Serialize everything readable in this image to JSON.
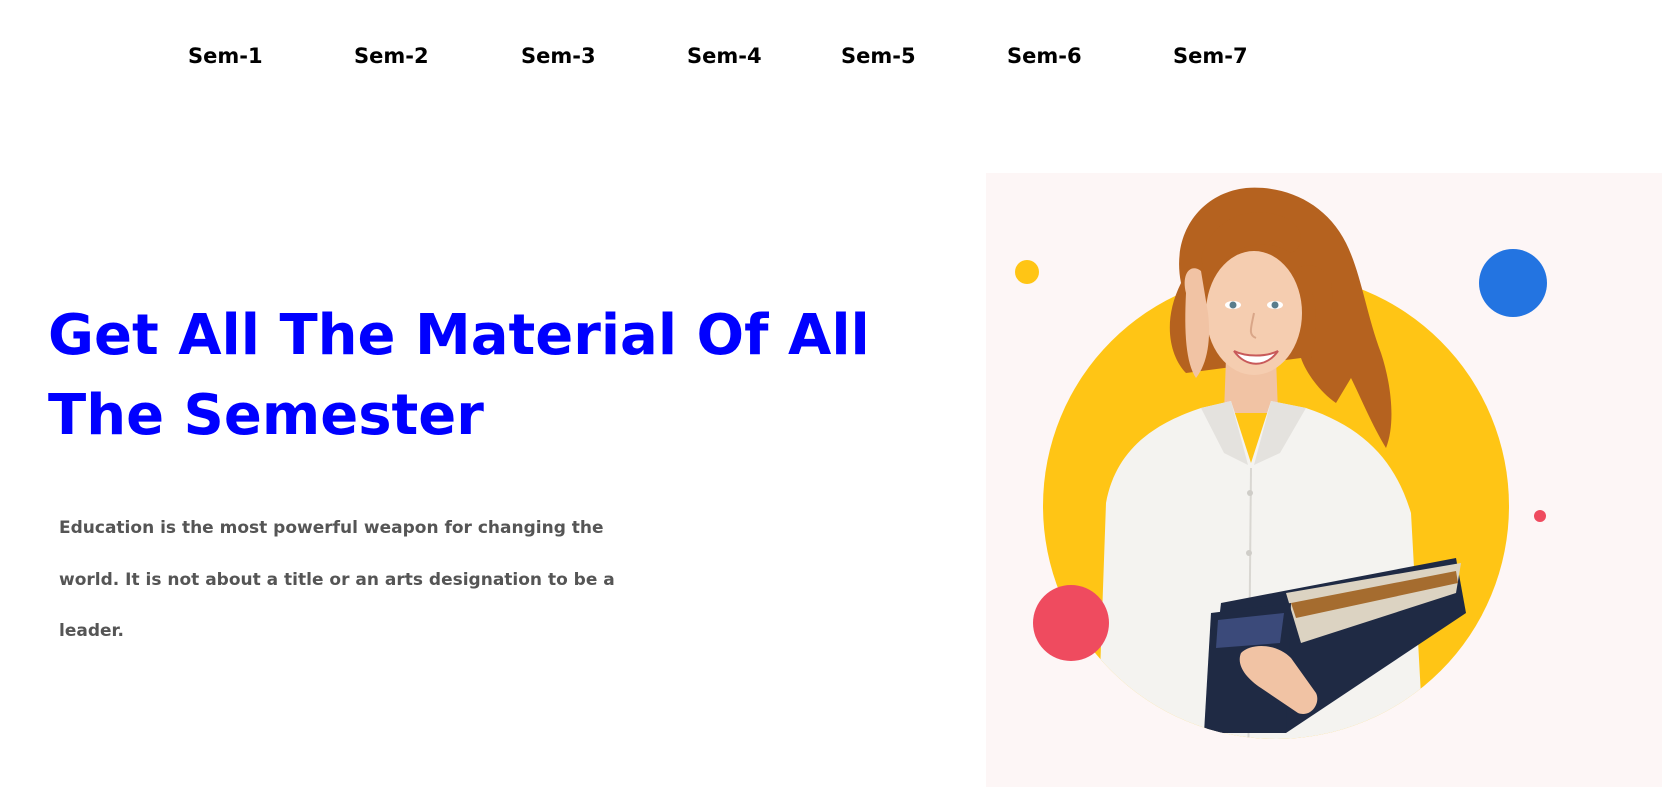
{
  "nav": {
    "items": [
      {
        "label": "Sem-1"
      },
      {
        "label": "Sem-2"
      },
      {
        "label": "Sem-3"
      },
      {
        "label": "Sem-4"
      },
      {
        "label": "Sem-5"
      },
      {
        "label": "Sem-6"
      },
      {
        "label": "Sem-7"
      }
    ]
  },
  "hero": {
    "title": "Get All The Material Of All The Semester",
    "description": "Education is the most powerful weapon for changing the world. It is not about a title or an arts designation to be a leader."
  },
  "illustration": {
    "subject": "student-holding-books",
    "colors": {
      "title": "#0000ff",
      "text": "#555555",
      "panel_background": "#fdf6f6",
      "circle_yellow": "#ffc515",
      "dot_blue": "#2374e1",
      "dot_red": "#ef4b5f",
      "hair": "#b5621f",
      "shirt": "#f4f3f0",
      "book_dark": "#1f2a44"
    }
  }
}
